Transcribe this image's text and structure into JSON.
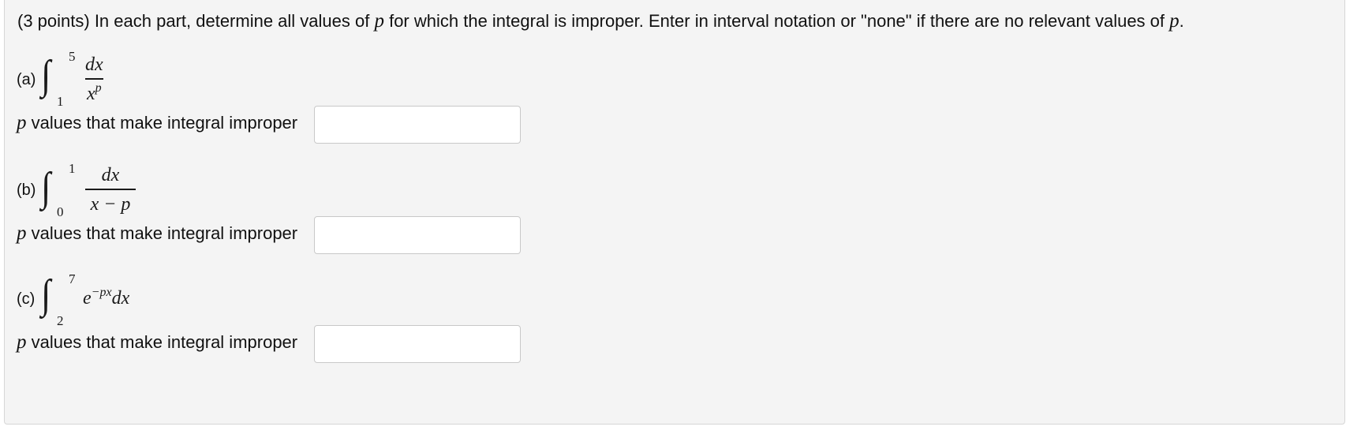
{
  "intro": {
    "part1": "(3 points) In each part, determine all values of ",
    "var1": "p",
    "part2": " for which the integral is improper. Enter in interval notation or \"none\" if there are no relevant values of ",
    "var2": "p",
    "part3": "."
  },
  "parts": [
    {
      "label": "(a)",
      "upper": "5",
      "lower": "1",
      "numerator": "dx",
      "denominator_base": "x",
      "denominator_exp": "p",
      "prompt_var": "p",
      "prompt_text": " values that make integral improper",
      "answer_value": "",
      "answer_placeholder": ""
    },
    {
      "label": "(b)",
      "upper": "1",
      "lower": "0",
      "numerator": "dx",
      "denominator": "x − p",
      "prompt_var": "p",
      "prompt_text": " values that make integral improper",
      "answer_value": "",
      "answer_placeholder": ""
    },
    {
      "label": "(c)",
      "upper": "7",
      "lower": "2",
      "integrand_base": "e",
      "integrand_exp": "−px",
      "integrand_tail": "dx",
      "prompt_var": "p",
      "prompt_text": " values that make integral improper",
      "answer_value": "",
      "answer_placeholder": ""
    }
  ]
}
